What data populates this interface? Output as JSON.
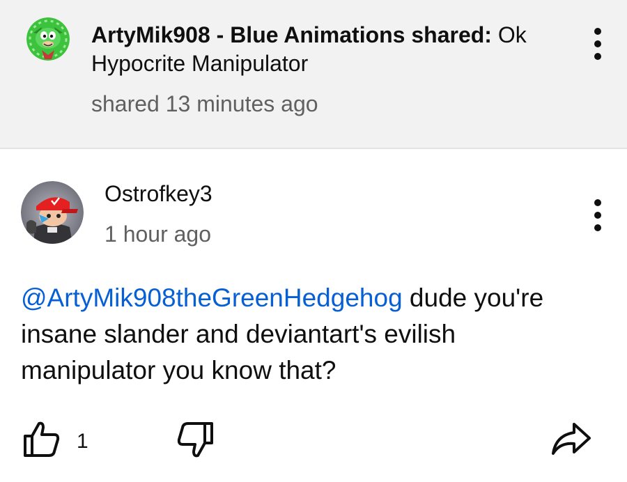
{
  "share": {
    "channel_name": "ArtyMik908 - Blue Animations shared:",
    "message": " Ok Hypocrite Manipulator",
    "time": "shared 13 minutes ago",
    "avatar_icon": "green-hedgehog-avatar",
    "menu_icon": "more-vert-icon"
  },
  "comment": {
    "author": "Ostrofkey3",
    "time": "1 hour ago",
    "mention": "@ArtyMik908theGreenHedgehog",
    "body": " dude you're insane slander and deviantart's evilish manipulator you know that?",
    "avatar_icon": "red-cap-character-avatar",
    "menu_icon": "more-vert-icon",
    "like_count": "1",
    "like_icon": "thumbs-up-icon",
    "dislike_icon": "thumbs-down-icon",
    "share_icon": "share-arrow-icon"
  },
  "colors": {
    "header_bg": "#f2f2f2",
    "mention_blue": "#065fd4",
    "secondary_text": "#606060"
  }
}
